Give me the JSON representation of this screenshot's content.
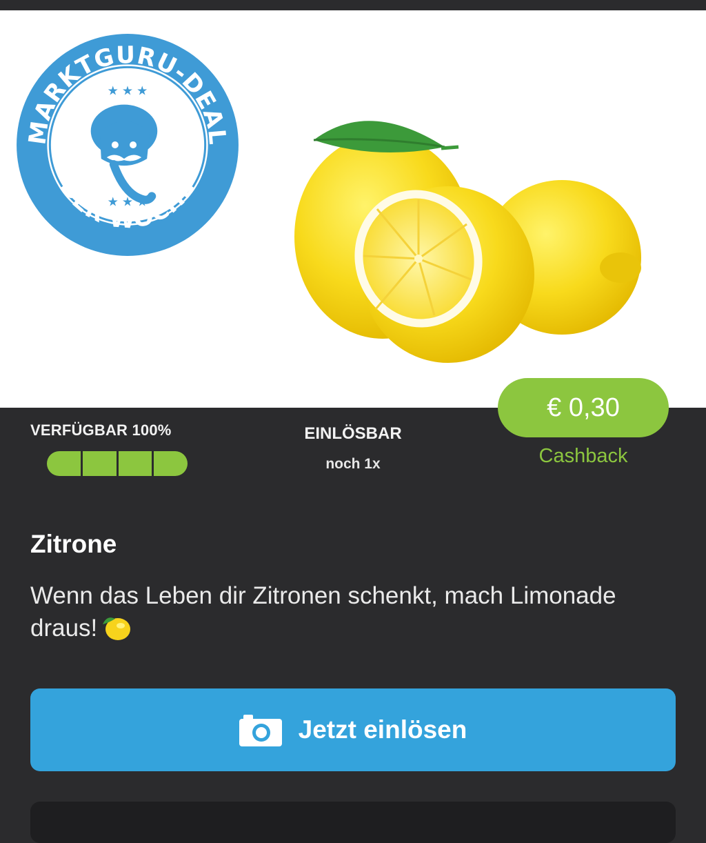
{
  "badge": {
    "top_text": "MARKTGURU-DEAL",
    "bottom_text": "DER WOCHE",
    "color": "#3f9bd6"
  },
  "product_image": {
    "icon": "lemon-photo"
  },
  "availability": {
    "label": "VERFÜGBAR 100%",
    "percent": 100,
    "segments": 4
  },
  "redeemable": {
    "label": "EINLÖSBAR",
    "count_text": "noch 1x"
  },
  "price": {
    "value": "€ 0,30",
    "label": "Cashback"
  },
  "product": {
    "title": "Zitrone",
    "description": "Wenn das Leben dir Zitronen schenkt, mach Limonade draus!",
    "description_emoji": "lemon-emoji"
  },
  "cta": {
    "label": "Jetzt einlösen",
    "icon": "camera-icon"
  },
  "colors": {
    "accent_green": "#8cc63f",
    "button_blue": "#34a3dc",
    "background_dark": "#2b2b2d"
  }
}
